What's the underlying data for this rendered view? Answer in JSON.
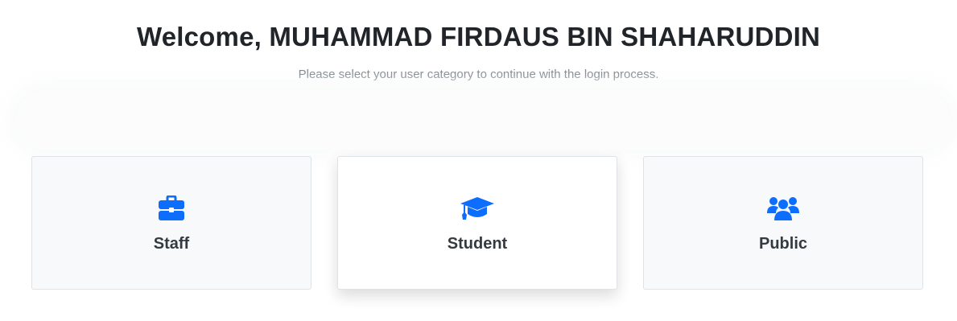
{
  "header": {
    "title": "Welcome, MUHAMMAD FIRDAUS BIN SHAHARUDDIN",
    "subtitle": "Please select your user category to continue with the login process."
  },
  "categories": [
    {
      "label": "Staff",
      "icon": "briefcase-icon"
    },
    {
      "label": "Student",
      "icon": "graduation-cap-icon",
      "selected": true
    },
    {
      "label": "Public",
      "icon": "users-icon"
    }
  ],
  "colors": {
    "accent": "#0d6efd",
    "card_bg": "#f8f9fa",
    "card_border": "#dfe2e6",
    "title": "#212529",
    "subtitle": "#7a8088"
  }
}
